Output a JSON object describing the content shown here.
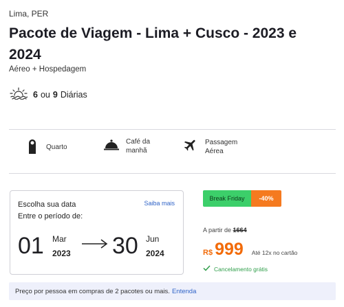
{
  "header": {
    "location": "Lima, PER",
    "title": "Pacote de Viagem - Lima + Cusco - 2023 e 2024",
    "subtitle": "Aéreo + Hospedagem"
  },
  "nights": {
    "icon": "sunrise-icon",
    "first": "6",
    "connector": "ou",
    "second": "9",
    "label": "Diárias"
  },
  "amenities": [
    {
      "icon": "door-hanger-icon",
      "label_line1": "Quarto",
      "label_line2": ""
    },
    {
      "icon": "cloche-icon",
      "label_line1": "Café da",
      "label_line2": "manhã"
    },
    {
      "icon": "airplane-icon",
      "label_line1": "Passagem",
      "label_line2": "Aérea"
    }
  ],
  "dates": {
    "choose_label": "Escolha sua data",
    "period_label": "Entre o período de:",
    "more_link": "Saiba mais",
    "start": {
      "day": "01",
      "month": "Mar",
      "year": "2023"
    },
    "end": {
      "day": "30",
      "month": "Jun",
      "year": "2024"
    }
  },
  "promo": {
    "badge_label": "Break Friday",
    "discount": "-40%",
    "badge_color": "#3ccf6a",
    "discount_color": "#f57a1f"
  },
  "pricing": {
    "from_label": "A partir de",
    "old_price": "1664",
    "currency": "R$",
    "price": "999",
    "installments": "Até 12x no cartão",
    "cancellation": "Cancelamento grátis",
    "price_color": "#f26b0a"
  },
  "footer": {
    "text": "Preço por pessoa em compras de 2 pacotes ou mais.",
    "link": "Entenda"
  }
}
